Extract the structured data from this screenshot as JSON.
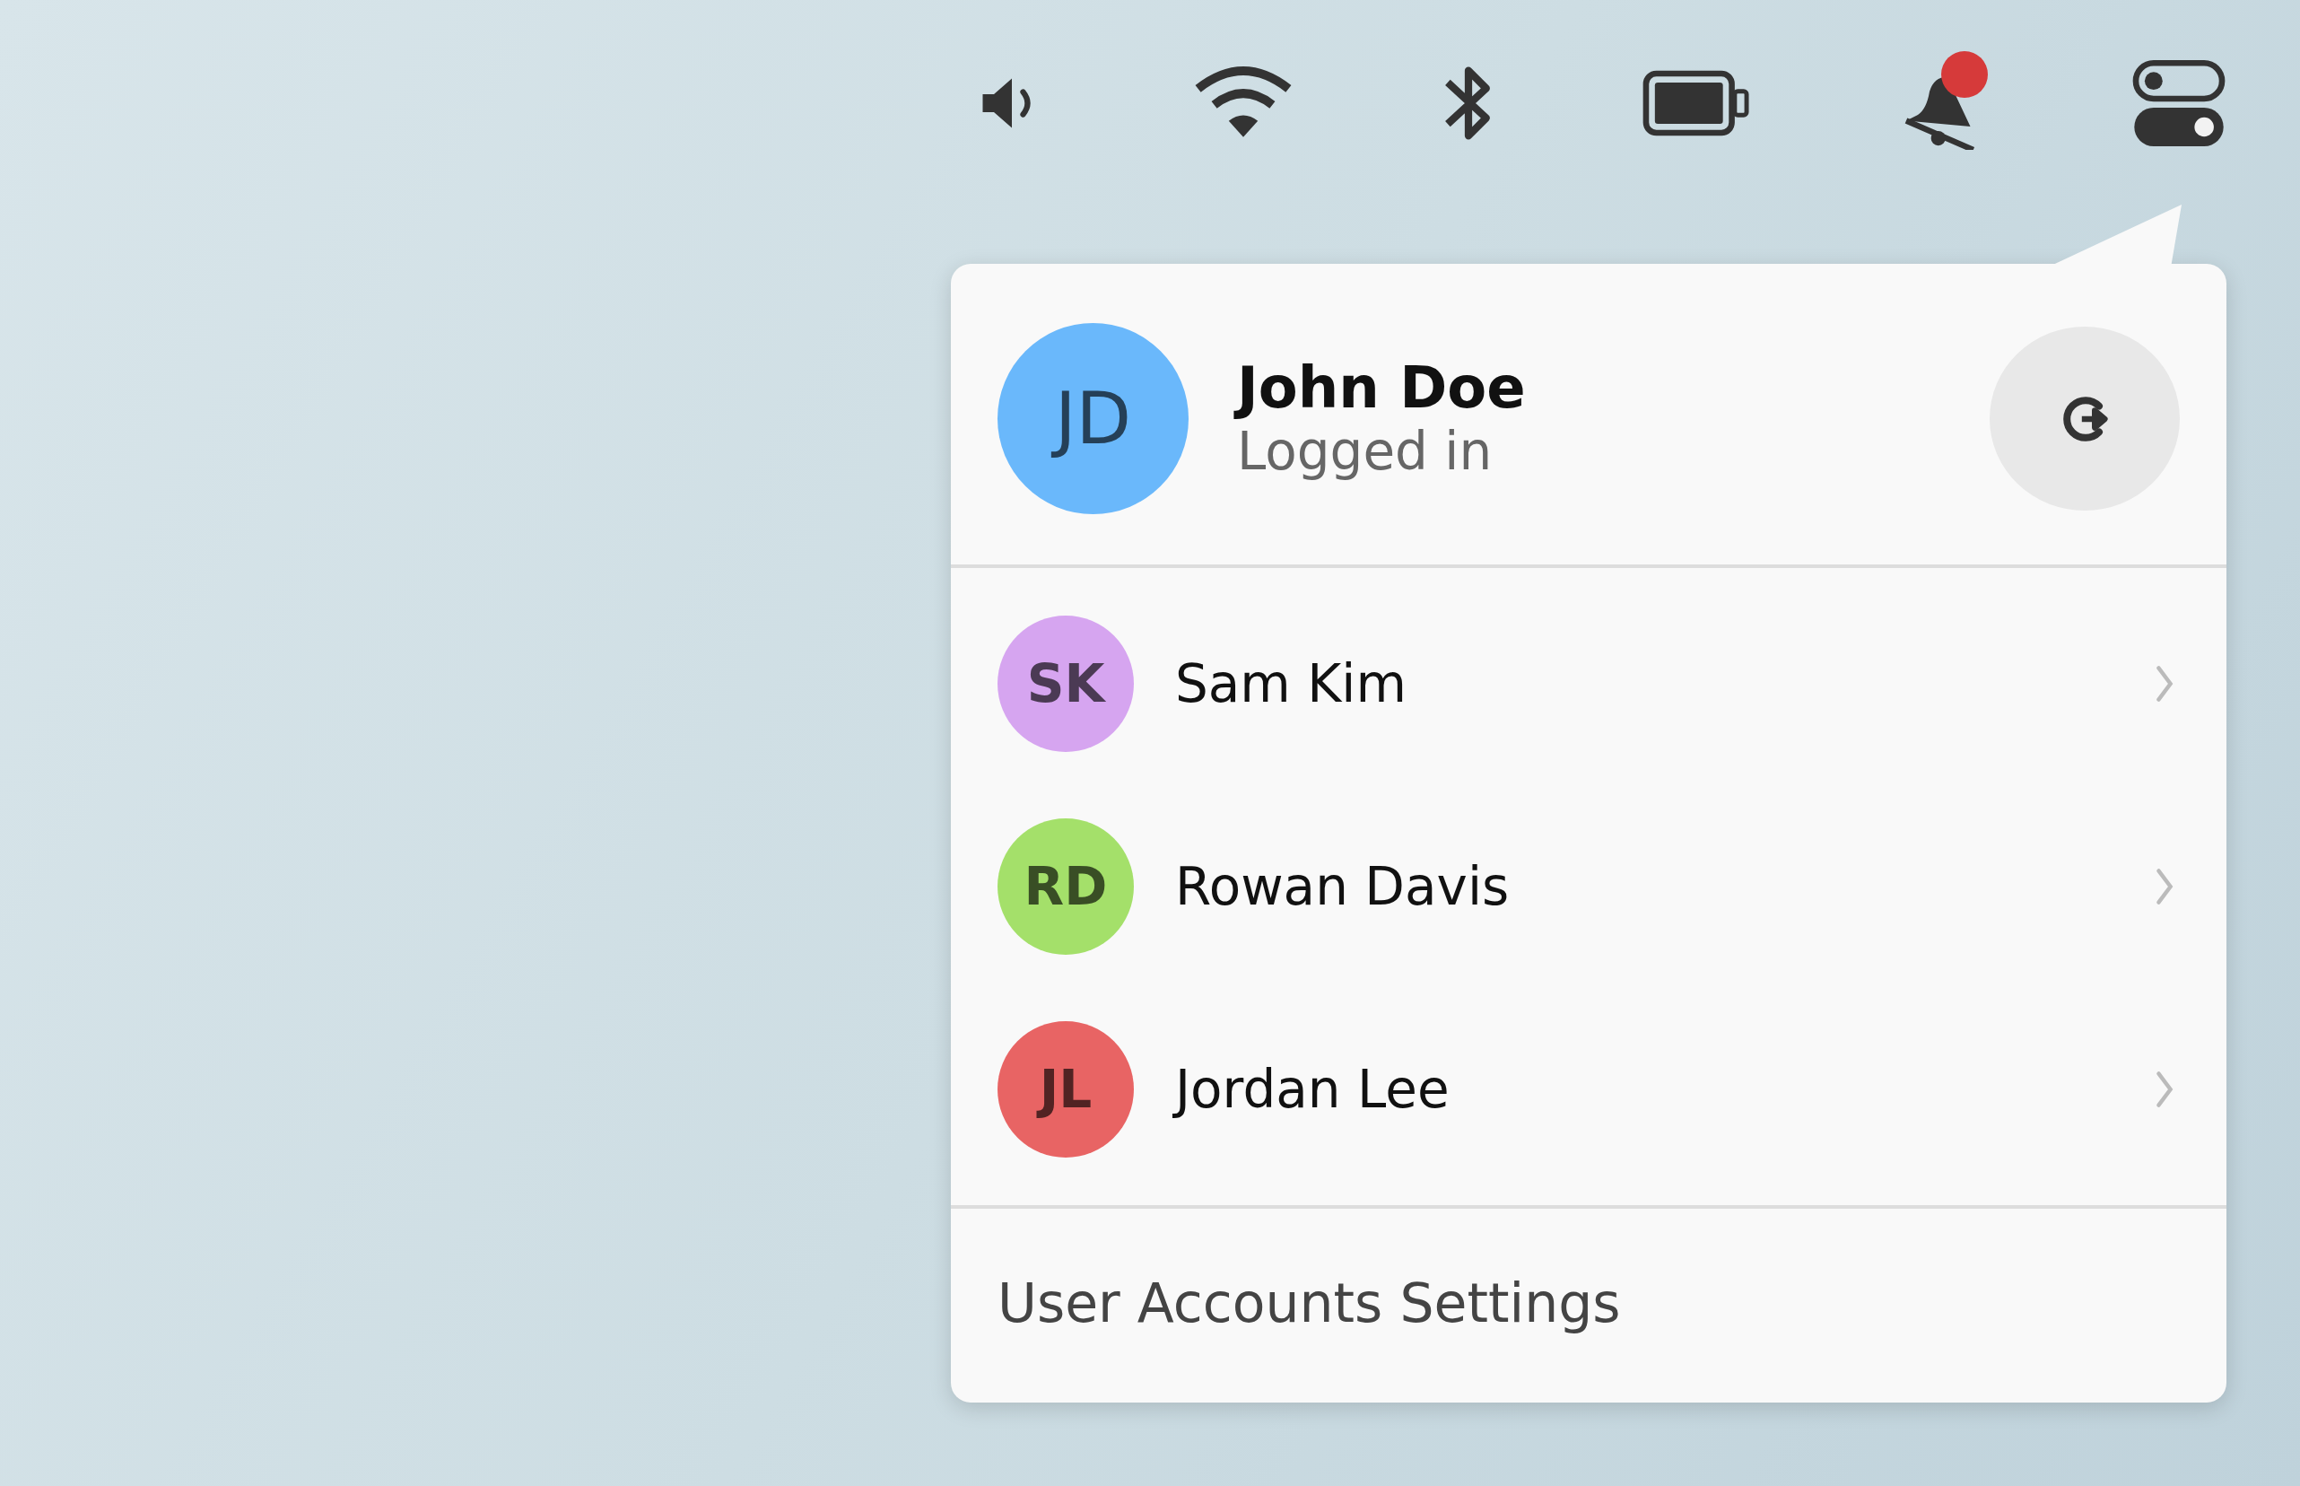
{
  "status_bar": {
    "icons": [
      {
        "kind": "volume"
      },
      {
        "kind": "wifi"
      },
      {
        "kind": "bluetooth"
      },
      {
        "kind": "battery"
      },
      {
        "kind": "notifications",
        "badge": true
      },
      {
        "kind": "toggles"
      }
    ]
  },
  "account_menu": {
    "current_user": {
      "initials": "JD",
      "name": "John Doe",
      "status": "Logged in",
      "color": "#6ab8fb"
    },
    "accounts": [
      {
        "initials": "SK",
        "name": "Sam Kim",
        "color": "#d6a5f0"
      },
      {
        "initials": "RD",
        "name": "Rowan Davis",
        "color": "#a4e06a"
      },
      {
        "initials": "JL",
        "name": "Jordan Lee",
        "color": "#e86464"
      }
    ],
    "settings_link": "User Accounts Settings"
  }
}
